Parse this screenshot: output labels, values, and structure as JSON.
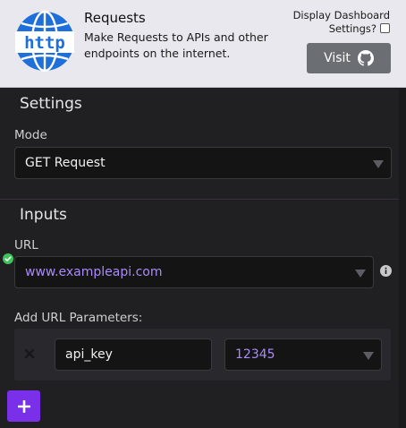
{
  "header": {
    "title": "Requests",
    "description": "Make Requests to APIs and other endpoints on the internet.",
    "logo_text": "http",
    "dashboard_label_line1": "Display Dashboard",
    "dashboard_label_line2": "Settings?",
    "dashboard_checked": false,
    "visit_label": "Visit"
  },
  "settings": {
    "title": "Settings",
    "mode_label": "Mode",
    "mode_value": "GET Request"
  },
  "inputs": {
    "title": "Inputs",
    "url_label": "URL",
    "url_value": "www.exampleapi.com",
    "params_label": "Add URL Parameters:",
    "params": [
      {
        "key": "api_key",
        "value": "12345"
      }
    ]
  },
  "colors": {
    "accent": "#7a30e8",
    "link_text": "#a98bf7",
    "success": "#3ec25a"
  },
  "icons": {
    "logo": "globe-http-icon",
    "visit": "github-icon",
    "url_status": "check-circle-icon",
    "url_info": "info-icon",
    "remove_param": "close-icon",
    "add_param": "plus-icon"
  }
}
